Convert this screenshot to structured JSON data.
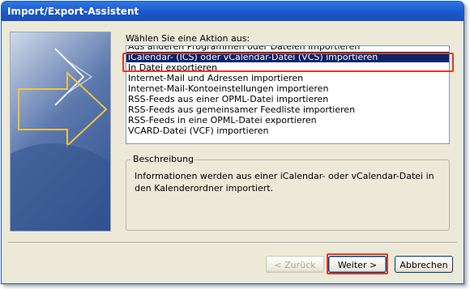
{
  "window": {
    "title": "Import/Export-Assistent"
  },
  "prompt": "Wählen Sie eine Aktion aus:",
  "actions": {
    "items": [
      "Aus anderen Programmen oder Dateien importieren",
      "iCalendar- (ICS) oder vCalendar-Datei (VCS) importieren",
      "In Datei exportieren",
      "Internet-Mail und Adressen importieren",
      "Internet-Mail-Kontoeinstellungen importieren",
      "RSS-Feeds aus einer OPML-Datei importieren",
      "RSS-Feeds aus gemeinsamer Feedliste importieren",
      "RSS-Feeds in eine OPML-Datei exportieren",
      "VCARD-Datei (VCF) importieren"
    ],
    "selected_index": 1
  },
  "description": {
    "label": "Beschreibung",
    "text": "Informationen werden aus einer iCalendar- oder vCalendar-Datei in den Kalenderordner importiert."
  },
  "buttons": {
    "back": "< Zurück",
    "next": "Weiter >",
    "cancel": "Abbrechen"
  },
  "colors": {
    "titlebar": "#1b57c8",
    "selection": "#0a246a",
    "highlight": "#e23b1e"
  }
}
